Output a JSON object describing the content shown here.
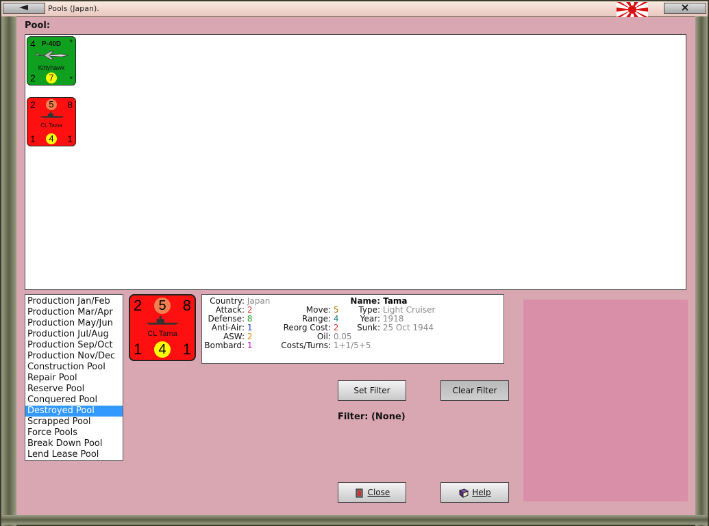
{
  "window": {
    "title": "Pools (Japan).",
    "pool_label": "Pool:"
  },
  "pool_counters": [
    {
      "kind": "air",
      "color": "#10a020",
      "top_left": "4",
      "top_right": "*",
      "bottom_left": "2",
      "bottom_right": "*",
      "model": "P-40D",
      "name": "Kittyhawk",
      "circle": "7",
      "circle_color": "#ffff00"
    },
    {
      "kind": "ship",
      "color": "#ff1010",
      "top_left": "2",
      "top_right": "8",
      "bottom_left": "1",
      "bottom_right": "1",
      "name": "CL Tama",
      "top_circle": "5",
      "top_circle_color": "#f08050",
      "bottom_circle": "4",
      "bottom_circle_color": "#ffff00"
    }
  ],
  "pool_list": [
    "Production Jan/Feb",
    "Production Mar/Apr",
    "Production May/Jun",
    "Production Jul/Aug",
    "Production Sep/Oct",
    "Production Nov/Dec",
    "Construction Pool",
    "Repair Pool",
    "Reserve Pool",
    "Conquered Pool",
    "Destroyed Pool",
    "Scrapped Pool",
    "Force Pools",
    "Break Down Pool",
    "Lend Lease Pool"
  ],
  "selected_pool": "Destroyed Pool",
  "selected_unit": {
    "top_left": "2",
    "top_circle": "5",
    "top_right": "8",
    "name": "CL Tama",
    "bottom_left": "1",
    "bottom_circle": "4",
    "bottom_right": "1"
  },
  "info": {
    "country_label": "Country:",
    "country": "Japan",
    "attack_label": "Attack:",
    "attack": "2",
    "defense_label": "Defense:",
    "defense": "8",
    "antiair_label": "Anti-Air:",
    "antiair": "1",
    "asw_label": "ASW:",
    "asw": "2",
    "bombard_label": "Bombard:",
    "bombard": "1",
    "move_label": "Move:",
    "move": "5",
    "range_label": "Range:",
    "range": "4",
    "reorg_label": "Reorg Cost:",
    "reorg": "2",
    "oil_label": "Oil:",
    "oil": "0.05",
    "costs_label": "Costs/Turns:",
    "costs": "1+1/5+5",
    "name_label": "Name:",
    "name": "Tama",
    "type_label": "Type:",
    "type": "Light Cruiser",
    "year_label": "Year:",
    "year": "1918",
    "sunk_label": "Sunk:",
    "sunk": "25 Oct 1944"
  },
  "value_colors": {
    "country": "#888888",
    "attack": "#e03030",
    "defense": "#20a020",
    "antiair": "#2040c0",
    "asw": "#e08000",
    "bombard": "#c020c0",
    "move": "#b08000",
    "range": "#208080",
    "reorg": "#e03030",
    "oil": "#888888",
    "costs": "#888888",
    "type": "#888888",
    "year": "#888888",
    "sunk": "#888888"
  },
  "buttons": {
    "set_filter": "Set Filter",
    "clear_filter": "Clear Filter",
    "close": "Close",
    "help": "Help"
  },
  "filter": {
    "label": "Filter:",
    "value": "(None)"
  }
}
